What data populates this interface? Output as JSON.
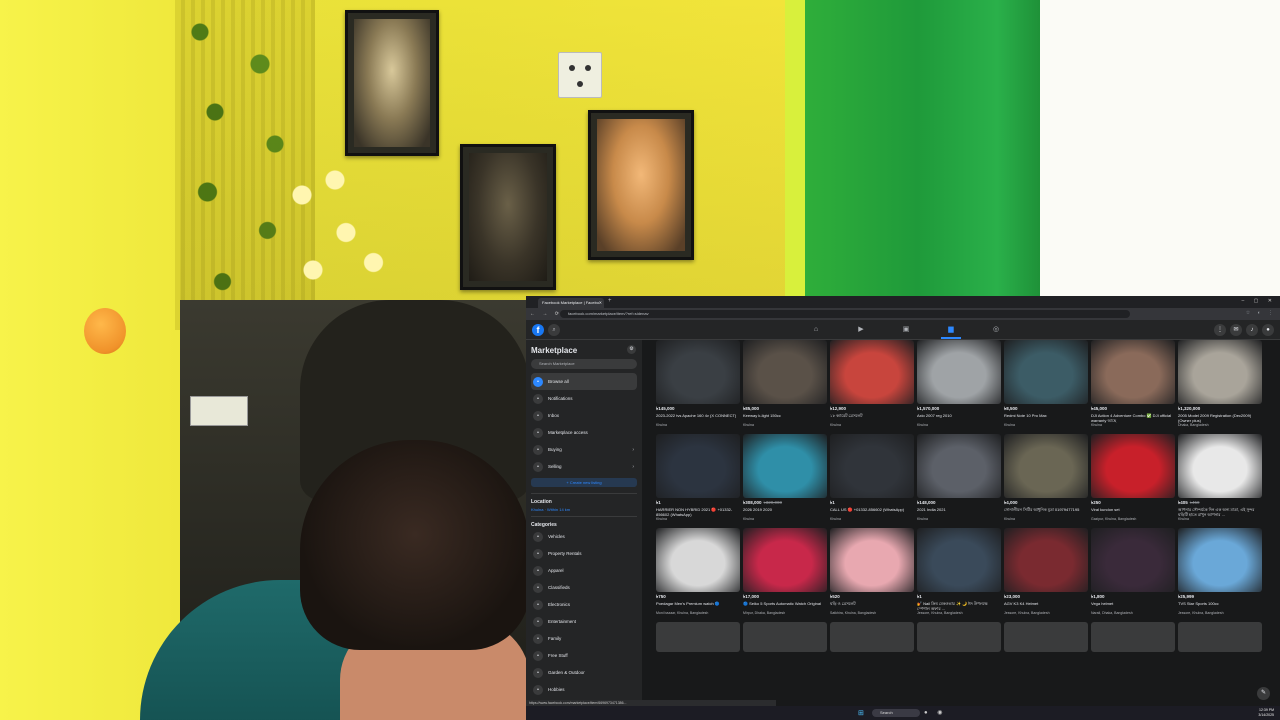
{
  "browser": {
    "tab_title": "Facebook Marketplace | Facebo",
    "url": "facebook.com/marketplace/item/?ref=sidenav",
    "status_url": "https://www.facebook.com/marketplace/item/6696973471386..."
  },
  "sidebar": {
    "title": "Marketplace",
    "search_placeholder": "Search Marketplace",
    "nav": [
      {
        "label": "Browse all",
        "icon": "store-icon"
      },
      {
        "label": "Notifications",
        "icon": "bell-icon"
      },
      {
        "label": "Inbox",
        "icon": "inbox-icon"
      },
      {
        "label": "Marketplace access",
        "icon": "user-icon"
      },
      {
        "label": "Buying",
        "icon": "bag-icon"
      },
      {
        "label": "Selling",
        "icon": "tag-icon"
      }
    ],
    "create_label": "+ Create new listing",
    "location_heading": "Location",
    "location_value": "Khulna · Within 14 km",
    "categories_heading": "Categories",
    "categories": [
      "Vehicles",
      "Property Rentals",
      "Apparel",
      "Classifieds",
      "Electronics",
      "Entertainment",
      "Family",
      "Free Stuff",
      "Garden & Outdoor",
      "Hobbies"
    ]
  },
  "listings": [
    {
      "price": "৳145,000",
      "old_price": "",
      "title": "2023-2022 tvs Apache 160 4v (X CONNECT)",
      "location": "Khulna",
      "color": "#3a3f44"
    },
    {
      "price": "৳85,000",
      "old_price": "",
      "title": "Keeway k-light 150cc",
      "location": "Khulna",
      "color": "#5a5148"
    },
    {
      "price": "৳12,900",
      "old_price": "",
      "title": "১৮ ক্যারেট ব্রেসলেট",
      "location": "Khulna",
      "color": "#c8453d"
    },
    {
      "price": "৳1,570,000",
      "old_price": "",
      "title": "Axio 2007 reg 2010",
      "location": "Khulna",
      "color": "#9fa3a6"
    },
    {
      "price": "৳8,500",
      "old_price": "",
      "title": "Redmi Note 10 Pro Max",
      "location": "Khulna",
      "color": "#3c5c66"
    },
    {
      "price": "৳45,000",
      "old_price": "",
      "title": "DJI Action 4 Adventure Combo ✅ DJI official warranty আছে",
      "location": "Khulna",
      "color": "#8a6a5a"
    },
    {
      "price": "৳1,320,000",
      "old_price": "",
      "title": "2005 Model 2009 Registration (Dec2009) (Owner plus)",
      "location": "Dhaka, Bangladesh",
      "color": "#a9a49a"
    },
    {
      "price": "৳1",
      "old_price": "",
      "title": "HARRIER NON HYBRID 2021 🔴 +01332-856602 (WhatsApp)",
      "location": "Khulna",
      "color": "#2c3440"
    },
    {
      "price": "৳308,000",
      "old_price": "৳320,000",
      "title": "2026 2019 2020",
      "location": "Khulna",
      "color": "#2f8fa8"
    },
    {
      "price": "৳1",
      "old_price": "",
      "title": "CALL US 🔴 +01332-856602 (WhatsApp)",
      "location": "Khulna",
      "color": "#30343a"
    },
    {
      "price": "৳148,000",
      "old_price": "",
      "title": "2021 India 2021",
      "location": "Khulna",
      "color": "#5c6068"
    },
    {
      "price": "৳4,000",
      "old_price": "",
      "title": "সোনালীয়ন সিটির আধুনিক মুদ্রা 01979477195",
      "location": "Khulna",
      "color": "#6a6654"
    },
    {
      "price": "৳250",
      "old_price": "",
      "title": "Viral kundon set",
      "location": "Gazipur, Khulna, Bangladesh",
      "color": "#c8202a"
    },
    {
      "price": "৳405",
      "old_price": "৳450",
      "title": "আপনার সৌন্দর্যকে দিন এক অন্য মাত্রা, এই সুন্দর ঘড়িটি হাতে রাখুন আপনার ...",
      "location": "Khulna",
      "color": "#e8e8e8"
    },
    {
      "price": "৳750",
      "old_price": "",
      "title": "Poedagar Men's Premium watch 🔵",
      "location": "Moni bazaar, Khulna, Bangladesh",
      "color": "#d8d8d8"
    },
    {
      "price": "৳17,000",
      "old_price": "",
      "title": "🔵 Seiko 5 Sports Automatic Watch Original",
      "location": "Mirpur, Dhaka, Bangladesh",
      "color": "#c8284a"
    },
    {
      "price": "৳520",
      "old_price": "",
      "title": "ঘড়ি ও ব্রেসলেট",
      "location": "Satkhira, Khulna, Bangladesh",
      "color": "#e8a8b0"
    },
    {
      "price": "৳1",
      "old_price": "",
      "title": "💅 Nail ক্রিম মেকওভার ✨ 🌙 ঈদ উপলক্ষে স্পেশাল অফার ...",
      "location": "Jessore, Khulna, Bangladesh",
      "color": "#3a4a5a"
    },
    {
      "price": "৳23,000",
      "old_price": "",
      "title": "AGV K3 K4 Helmet",
      "location": "Jessore, Khulna, Bangladesh",
      "color": "#7a2a30"
    },
    {
      "price": "৳1,800",
      "old_price": "",
      "title": "Vega helmet",
      "location": "Narail, Dhaka, Bangladesh",
      "color": "#3a2a3a"
    },
    {
      "price": "৳25,999",
      "old_price": "",
      "title": "TVS Star Sports 100cc",
      "location": "Jessore, Khulna, Bangladesh",
      "color": "#6aa8d8"
    }
  ],
  "taskbar": {
    "search_label": "Search",
    "time": "12:39 PM",
    "date": "3/14/2025"
  }
}
